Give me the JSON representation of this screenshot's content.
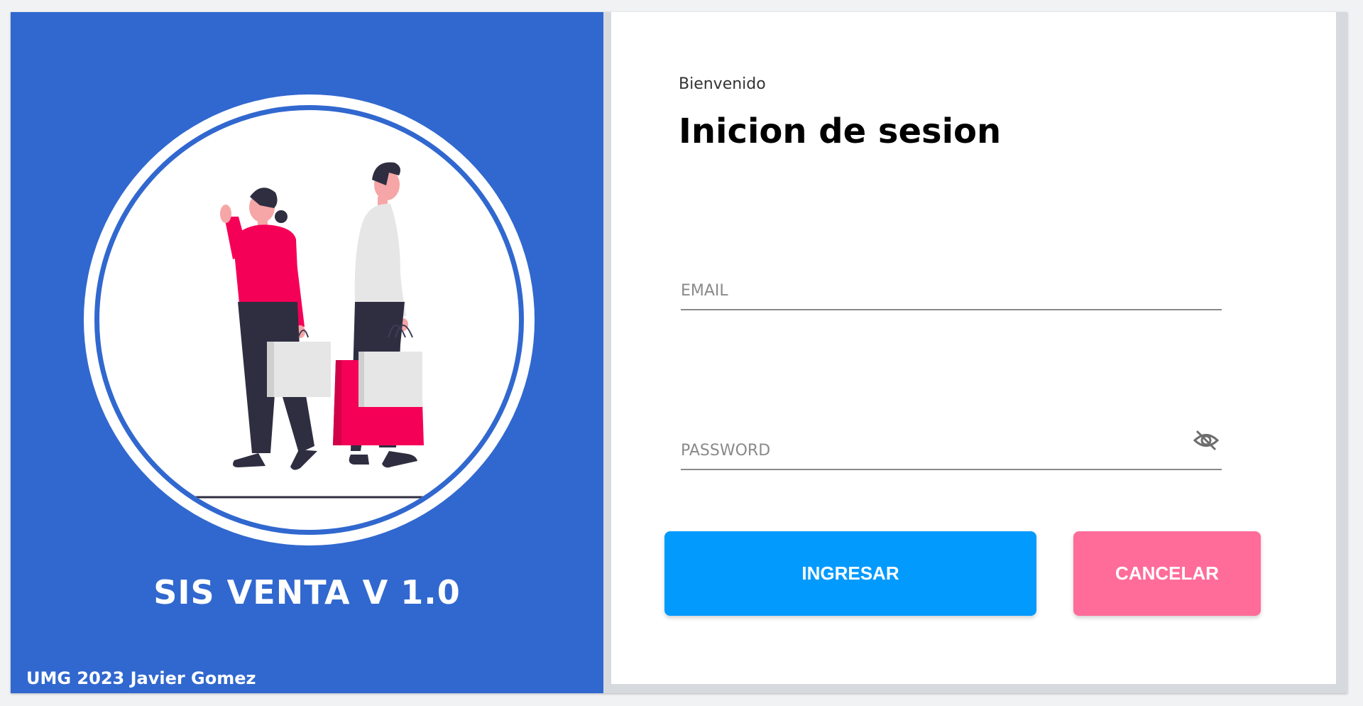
{
  "left_panel": {
    "app_title": "SIS VENTA V 1.0",
    "footer_credit": "UMG 2023 Javier Gomez",
    "background_color": "#3168cf"
  },
  "login": {
    "welcome_text": "Bienvenido",
    "heading": "Inicion de sesion",
    "email_placeholder": "EMAIL",
    "password_placeholder": "PASSWORD",
    "password_toggle_icon": "eye-off-icon",
    "submit_label": "INGRESAR",
    "cancel_label": "CANCELAR",
    "submit_color": "#039afe",
    "cancel_color": "#ff6c9a"
  }
}
